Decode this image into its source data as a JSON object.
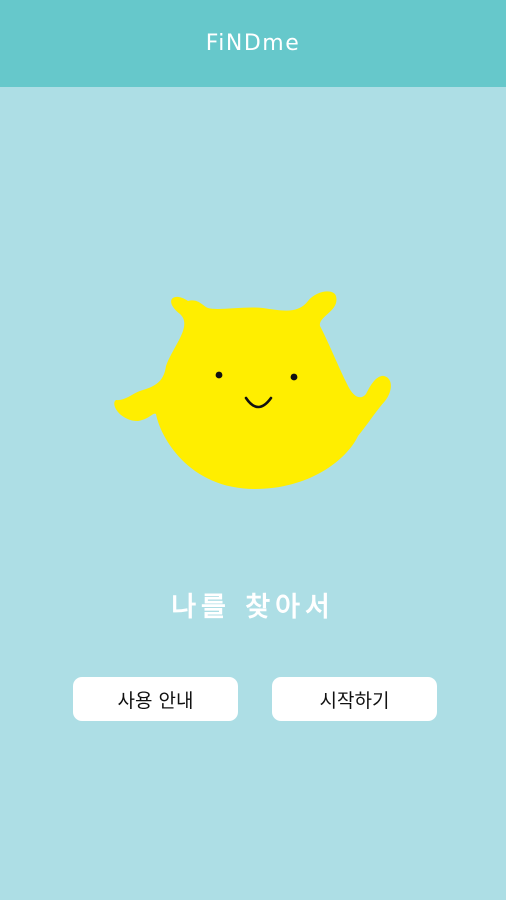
{
  "header": {
    "title": "FiNDme"
  },
  "main": {
    "mascot_icon": "yellow-blob-character-icon",
    "tagline": "나를 찾아서",
    "buttons": {
      "guide_label": "사용 안내",
      "start_label": "시작하기"
    }
  },
  "colors": {
    "header_bg": "#66C8CB",
    "page_bg": "#ADDEE5",
    "mascot_yellow": "#FFEE00",
    "button_bg": "#FFFFFF",
    "text_light": "#FFFFFF"
  }
}
